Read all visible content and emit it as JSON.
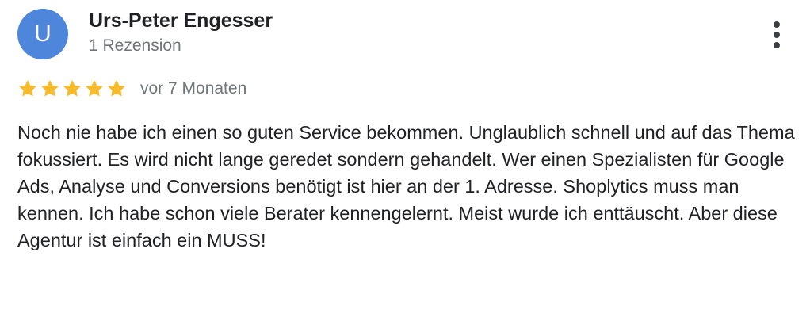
{
  "review": {
    "author": {
      "initial": "U",
      "name": "Urs-Peter Engesser",
      "meta": "1 Rezension",
      "avatar_color": "#4e86dc"
    },
    "menu_icon": "more-vertical-icon",
    "rating": {
      "value": 5,
      "max": 5,
      "star_color": "#f6bb2c"
    },
    "date": "vor 7 Monaten",
    "text": "Noch nie habe ich einen so guten Service bekommen. Unglaublich schnell und auf das Thema fokussiert. Es wird nicht lange geredet sondern gehandelt. Wer einen Spezialisten für Google Ads, Analyse und Conversions benötigt ist hier an der 1. Adresse. Shoplytics muss man kennen. Ich habe schon viele Berater kennengelernt. Meist wurde ich enttäuscht. Aber diese Agentur ist einfach ein MUSS!"
  }
}
